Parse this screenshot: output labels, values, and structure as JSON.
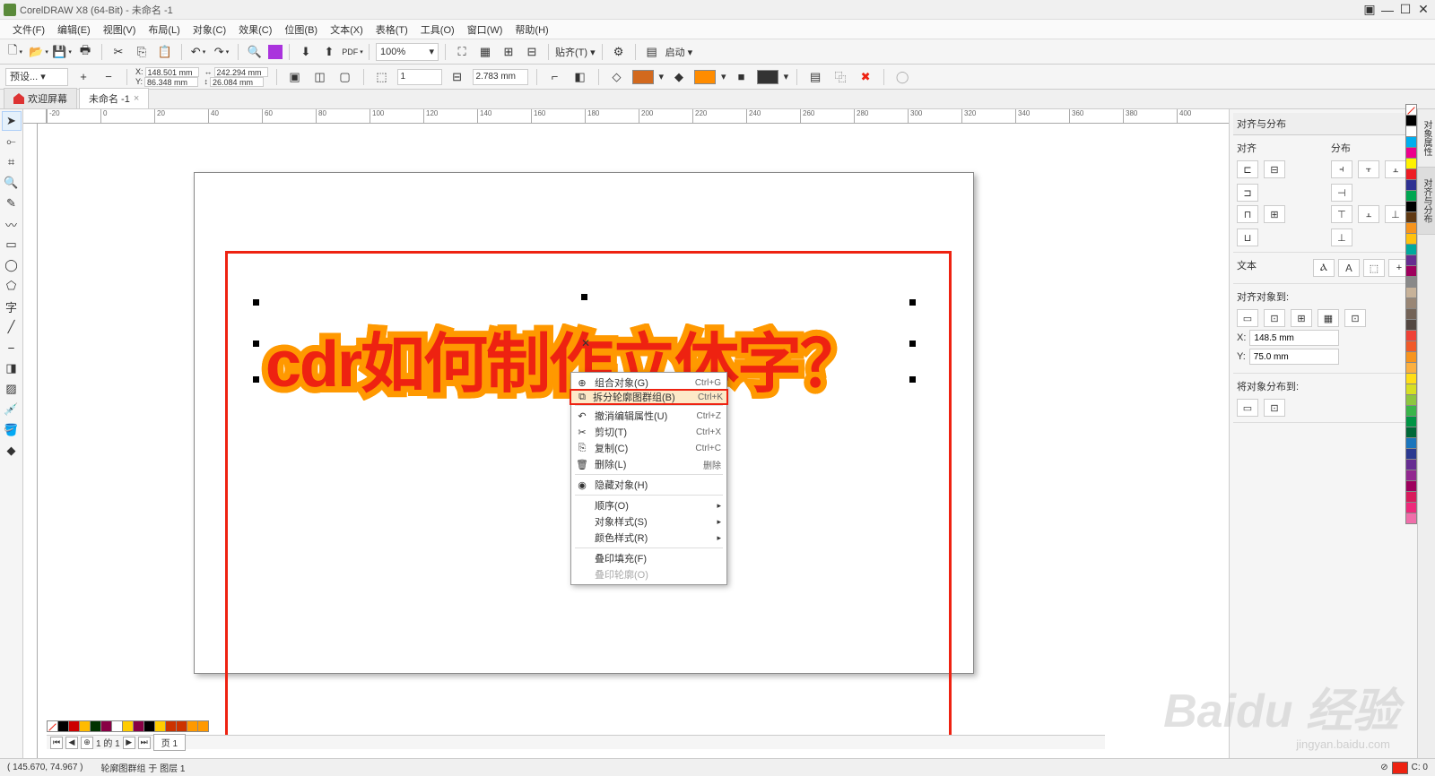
{
  "title": "CorelDRAW X8 (64-Bit) - 未命名 -1",
  "menus": [
    "文件(F)",
    "编辑(E)",
    "视图(V)",
    "布局(L)",
    "对象(C)",
    "效果(C)",
    "位图(B)",
    "文本(X)",
    "表格(T)",
    "工具(O)",
    "窗口(W)",
    "帮助(H)"
  ],
  "zoom": "100%",
  "launch_label": "启动",
  "snap_label": "贴齐(T)",
  "preset": "预设...",
  "coords": {
    "x": "148.501 mm",
    "y": "86.348 mm",
    "w": "242.294 mm",
    "h": "26.084 mm"
  },
  "outline_width": "2.783 mm",
  "copies": "1",
  "tabs": {
    "welcome": "欢迎屏幕",
    "doc": "未命名 -1"
  },
  "canvas_text": "cdr如何制作立体字？",
  "context_menu": [
    {
      "icon": "⊕",
      "label": "组合对象(G)",
      "shortcut": "Ctrl+G"
    },
    {
      "icon": "⧉",
      "label": "拆分轮廓图群组(B)",
      "shortcut": "Ctrl+K",
      "hl": true
    },
    {
      "sep": true
    },
    {
      "icon": "↶",
      "label": "撤消编辑属性(U)",
      "shortcut": "Ctrl+Z"
    },
    {
      "icon": "✂",
      "label": "剪切(T)",
      "shortcut": "Ctrl+X"
    },
    {
      "icon": "⎘",
      "label": "复制(C)",
      "shortcut": "Ctrl+C"
    },
    {
      "icon": "🗑",
      "label": "删除(L)",
      "shortcut": "删除"
    },
    {
      "sep": true
    },
    {
      "icon": "◉",
      "label": "隐藏对象(H)"
    },
    {
      "sep": true
    },
    {
      "label": "顺序(O)",
      "sub": true
    },
    {
      "label": "对象样式(S)",
      "sub": true
    },
    {
      "label": "颜色样式(R)",
      "sub": true
    },
    {
      "sep": true
    },
    {
      "label": "叠印填充(F)"
    },
    {
      "label": "叠印轮廓(O)",
      "disabled": true
    }
  ],
  "dock": {
    "title": "对齐与分布",
    "align_label": "对齐",
    "dist_label": "分布",
    "text_label": "文本",
    "align_to_label": "对齐对象到:",
    "x_val": "148.5 mm",
    "y_val": "75.0 mm",
    "distribute_to_label": "将对象分布到:",
    "tab1": "对象属性",
    "tab2": "对齐与分布"
  },
  "page_nav": {
    "info": "1 的 1",
    "page_label": "页 1"
  },
  "status": {
    "cursor": "( 145.670, 74.967 )",
    "obj": "轮廓图群组 于 图层 1",
    "fill_label": "C: 0"
  },
  "palette": [
    "#000",
    "#fff",
    "#00aeef",
    "#ec008c",
    "#fff200",
    "#ed1c24",
    "#2e3192",
    "#00a651",
    "#000",
    "#603913",
    "#f7941d",
    "#ffc20e",
    "#00a99d",
    "#662d91",
    "#9e005d",
    "#898989",
    "#c7b299",
    "#998675",
    "#736357",
    "#534741",
    "#ef4136",
    "#f15a29",
    "#f7941d",
    "#fbb040",
    "#ffde17",
    "#d7df23",
    "#8dc63f",
    "#39b54a",
    "#009444",
    "#006838",
    "#1b75bc",
    "#2b3990",
    "#662d91",
    "#92278f",
    "#9e005d",
    "#d91b5c",
    "#ee2a7b",
    "#f06eaa"
  ],
  "doc_palette": [
    "none",
    "#000",
    "#c00",
    "#fb0",
    "#030",
    "#804",
    "#fff",
    "#fc0",
    "#804",
    "#000",
    "#fc0",
    "#c30",
    "#c30",
    "#f90",
    "#f90"
  ],
  "watermark": "Baidu 经验",
  "watermark_url": "jingyan.baidu.com"
}
